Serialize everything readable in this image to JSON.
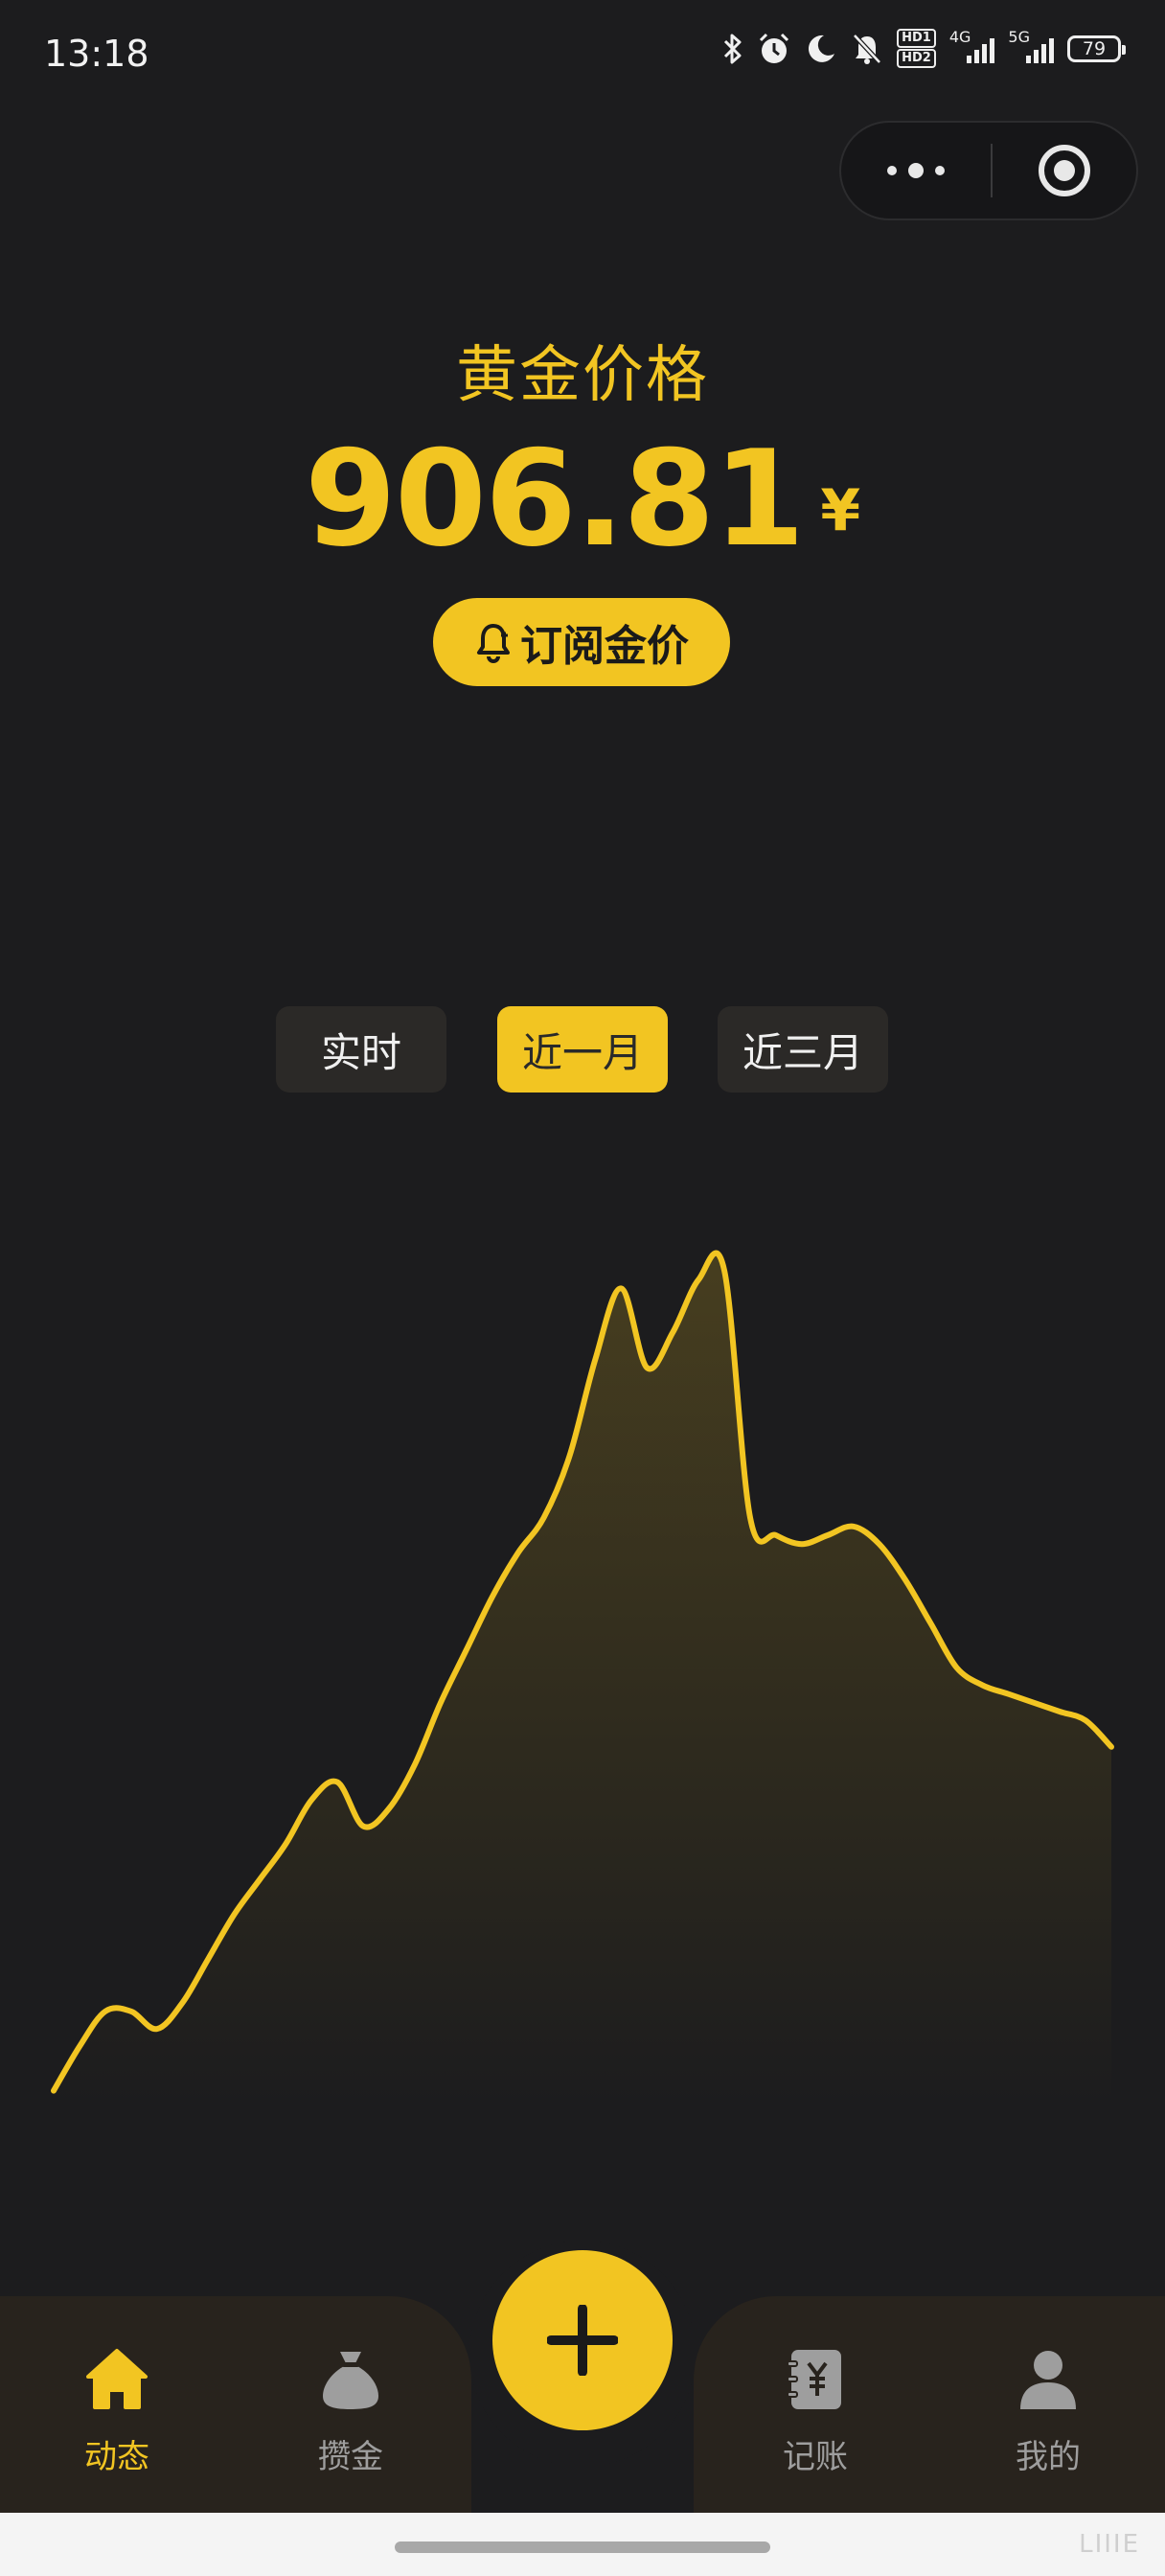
{
  "status_bar": {
    "time": "13:18",
    "icons": [
      "bluetooth-icon",
      "alarm-icon",
      "moon-icon",
      "mute-bell-icon",
      "hd-icon",
      "signal-4g-icon",
      "signal-5g-icon",
      "battery-icon"
    ],
    "hd_top": "HD1",
    "hd_bottom": "HD2",
    "net1": "4G",
    "net2": "5G",
    "battery": "79"
  },
  "capsule": {
    "more_icon": "more-dots-icon",
    "close_icon": "target-close-icon"
  },
  "header": {
    "title": "黄金价格",
    "price": "906.81",
    "currency": "¥",
    "subscribe_label": "订阅金价",
    "subscribe_icon": "bell-icon"
  },
  "tabs": [
    {
      "label": "实时",
      "active": false
    },
    {
      "label": "近一月",
      "active": true
    },
    {
      "label": "近三月",
      "active": false
    }
  ],
  "colors": {
    "accent": "#f2c522",
    "background": "#1c1c1e",
    "nav_background": "#28231d",
    "tab_background": "#2b2927",
    "inactive": "#9e9e9e"
  },
  "chart_data": {
    "type": "area",
    "title": "",
    "xlabel": "",
    "ylabel": "",
    "grid": false,
    "legend": "none",
    "ylim": [
      0,
      100
    ],
    "x": [
      1,
      2,
      3,
      4,
      5,
      6,
      7,
      8,
      9,
      10,
      11,
      12,
      13,
      14,
      15,
      16,
      17,
      18,
      19,
      20,
      21,
      22,
      23,
      24,
      25,
      26,
      27,
      28,
      29,
      30,
      31,
      32,
      33,
      34,
      35,
      36,
      37,
      38,
      39,
      40,
      41,
      42
    ],
    "series": [
      {
        "values": [
          2,
          7,
          11,
          11,
          9,
          12,
          17,
          22,
          26,
          30,
          35,
          37,
          32,
          34,
          39,
          46,
          52,
          58,
          63,
          67,
          74,
          85,
          93,
          84,
          88,
          94,
          95,
          67,
          65,
          64,
          65,
          66,
          64,
          60,
          55,
          50,
          48,
          47,
          46,
          45,
          44,
          41
        ]
      }
    ]
  },
  "bottom_nav": {
    "items": [
      {
        "label": "动态",
        "icon": "home-icon",
        "active": true
      },
      {
        "label": "攒金",
        "icon": "money-bag-icon",
        "active": false
      },
      {
        "label": "记账",
        "icon": "ledger-book-icon",
        "active": false
      },
      {
        "label": "我的",
        "icon": "user-icon",
        "active": false
      }
    ],
    "fab_icon": "plus-icon"
  },
  "home_bar": {
    "corner_mark": "LIIIE"
  }
}
